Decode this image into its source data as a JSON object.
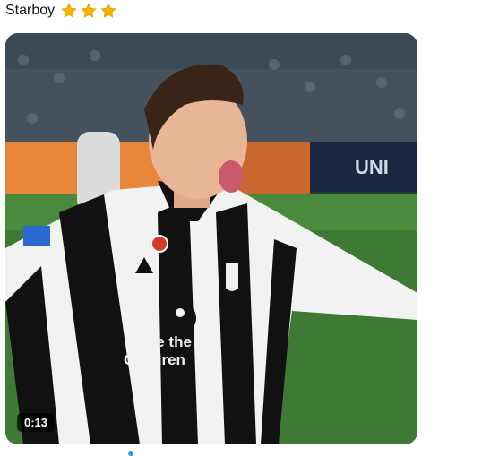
{
  "post": {
    "text": "Starboy",
    "emoji": [
      "star-icon",
      "star-icon",
      "star-icon"
    ]
  },
  "video": {
    "duration": "0:13",
    "ad_board_text": "UNI",
    "jersey_text_line1": "Save the",
    "jersey_text_line2": "Children"
  },
  "colors": {
    "star": "#f4b400",
    "pitch": "#3f7a34",
    "board_orange": "#e8873a",
    "jersey_black": "#111111",
    "jersey_white": "#f2f2f2"
  }
}
